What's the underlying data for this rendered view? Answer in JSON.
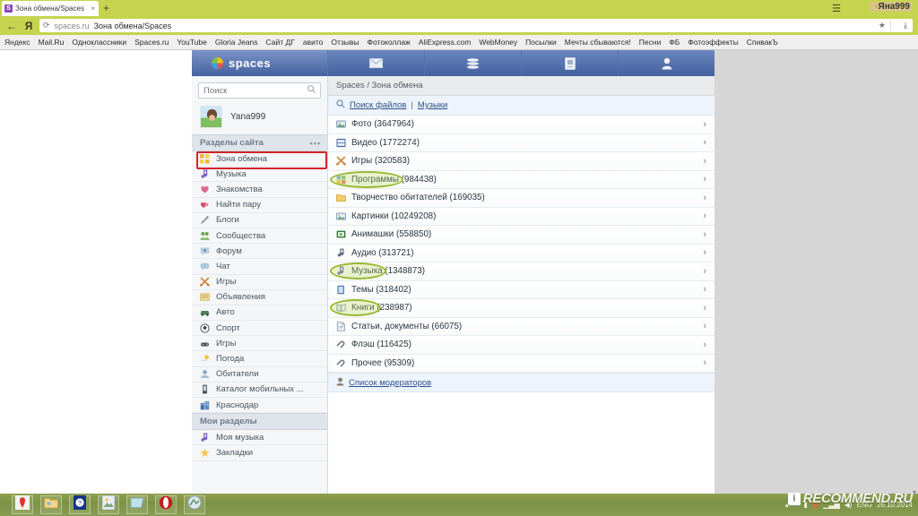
{
  "browser": {
    "tab": {
      "favicon_letter": "S",
      "title": "Зона обмена/Spaces",
      "close_label": "×"
    },
    "new_tab_label": "+",
    "menu_icon": "☰",
    "account_dash": "-",
    "account_name": "Яна999",
    "nav": {
      "back_icon": "←",
      "yandex_icon": "Я"
    },
    "omnibox": {
      "reload_icon": "⟳",
      "host": "spaces.ru",
      "title": "Зона обмена/Spaces",
      "star_icon": "★",
      "download_icon": "⤓"
    },
    "bookmarks": [
      "Яндекс",
      "Mail.Ru",
      "Одноклассники",
      "Spaces.ru",
      "YouTube",
      "Gloria Jeans",
      "Сайт ДГ",
      "авито",
      "Отзывы",
      "Фотоколлаж",
      "AliExpress.com",
      "WebMoney",
      "Посылки",
      "Мечты сбываются!",
      "Песни",
      "ФБ",
      "Фотоэффекты",
      "СпивакЪ"
    ]
  },
  "app": {
    "logo_text": "spaces",
    "nav_buttons": [
      {
        "name": "mail",
        "icon": "envelope-icon"
      },
      {
        "name": "feed",
        "icon": "stack-icon"
      },
      {
        "name": "notes",
        "icon": "note-icon"
      },
      {
        "name": "profile",
        "icon": "person-icon"
      }
    ],
    "sidebar": {
      "search_placeholder": "Поиск",
      "search_value": "",
      "search_icon": "search-icon",
      "username": "Yana999",
      "section_title": "Разделы сайта",
      "section_more": "•••",
      "items": [
        {
          "label": "Зона обмена",
          "icon": "grid-icon",
          "highlighted": true
        },
        {
          "label": "Музыка",
          "icon": "music-icon"
        },
        {
          "label": "Знакомства",
          "icon": "heart-icon"
        },
        {
          "label": "Найти пару",
          "icon": "hearts-icon"
        },
        {
          "label": "Блоги",
          "icon": "pen-icon"
        },
        {
          "label": "Сообщества",
          "icon": "people-icon"
        },
        {
          "label": "Форум",
          "icon": "forum-icon"
        },
        {
          "label": "Чат",
          "icon": "chat-icon"
        },
        {
          "label": "Игры",
          "icon": "games-icon"
        },
        {
          "label": "Объявления",
          "icon": "ads-icon"
        },
        {
          "label": "Авто",
          "icon": "car-icon"
        },
        {
          "label": "Спорт",
          "icon": "ball-icon"
        },
        {
          "label": "Игры",
          "icon": "joystick-icon"
        },
        {
          "label": "Погода",
          "icon": "weather-icon"
        },
        {
          "label": "Обитатели",
          "icon": "user-icon"
        },
        {
          "label": "Каталог мобильных ...",
          "icon": "phone-icon"
        },
        {
          "label": "Краснодар",
          "icon": "city-icon"
        }
      ],
      "my_section_title": "Мои разделы",
      "my_items": [
        {
          "label": "Моя музыка",
          "icon": "music-icon"
        },
        {
          "label": "Закладки",
          "icon": "star-icon"
        }
      ]
    },
    "main": {
      "breadcrumb": "Spaces / Зона обмена",
      "toolbar": {
        "icon": "search-files-icon",
        "link1": "Поиск файлов",
        "separator": "|",
        "link2": "Музыки"
      },
      "rows": [
        {
          "label": "Фото (3647964)",
          "icon": "photo-icon",
          "chevron": "›",
          "circled": false
        },
        {
          "label": "Видео (1772274)",
          "icon": "video-icon",
          "chevron": "›",
          "circled": false
        },
        {
          "label": "Игры (320583)",
          "icon": "games-icon",
          "chevron": "›",
          "circled": false
        },
        {
          "label": "Программы (984438)",
          "icon": "program-icon",
          "chevron": "›",
          "circled": true
        },
        {
          "label": "Творчество обитателей (169035)",
          "icon": "folder-icon",
          "chevron": "›",
          "circled": false
        },
        {
          "label": "Картинки (10249208)",
          "icon": "picture-icon",
          "chevron": "›",
          "circled": false
        },
        {
          "label": "Анимашки (558850)",
          "icon": "anim-icon",
          "chevron": "›",
          "circled": false
        },
        {
          "label": "Аудио (313721)",
          "icon": "audio-icon",
          "chevron": "›",
          "circled": false
        },
        {
          "label": "Музыка (1348873)",
          "icon": "music-icon",
          "chevron": "›",
          "circled": true
        },
        {
          "label": "Темы (318402)",
          "icon": "theme-icon",
          "chevron": "›",
          "circled": false
        },
        {
          "label": "Книги (238987)",
          "icon": "book-icon",
          "chevron": "›",
          "circled": true
        },
        {
          "label": "Статьи, документы (66075)",
          "icon": "doc-icon",
          "chevron": "›",
          "circled": false
        },
        {
          "label": "Флэш (116425)",
          "icon": "flash-icon",
          "chevron": "›",
          "circled": false
        },
        {
          "label": "Прочее (95309)",
          "icon": "other-icon",
          "chevron": "›",
          "circled": false
        }
      ],
      "moderators": {
        "icon": "moderator-icon",
        "label": "Список модераторов"
      }
    }
  },
  "taskbar": {
    "buttons": [
      {
        "name": "yandex-browser",
        "icon": "yandex-icon"
      },
      {
        "name": "file-explorer",
        "icon": "folder-icon"
      },
      {
        "name": "help",
        "icon": "question-icon"
      },
      {
        "name": "photo-viewer",
        "icon": "image-icon"
      },
      {
        "name": "notepad",
        "icon": "book-icon"
      },
      {
        "name": "opera",
        "icon": "opera-icon"
      },
      {
        "name": "paint",
        "icon": "paint-icon"
      }
    ],
    "tray": {
      "expand_icon": "▴",
      "bluetooth_icon": "✶",
      "network_icon": "▮",
      "antivirus_icon": "▣",
      "signal_icon": "▁▃▅",
      "volume_icon": "◀)",
      "language": "ENG",
      "date": "26.10.2014"
    },
    "watermark": {
      "badge": "i",
      "text": "RECOMMEND.RU"
    }
  },
  "colors": {
    "chrome_green": "#c5d44e",
    "app_header_blue": "#43619f",
    "highlight_red": "#d4242a",
    "highlight_green": "#9ab832",
    "link_blue": "#2c4f8a"
  }
}
